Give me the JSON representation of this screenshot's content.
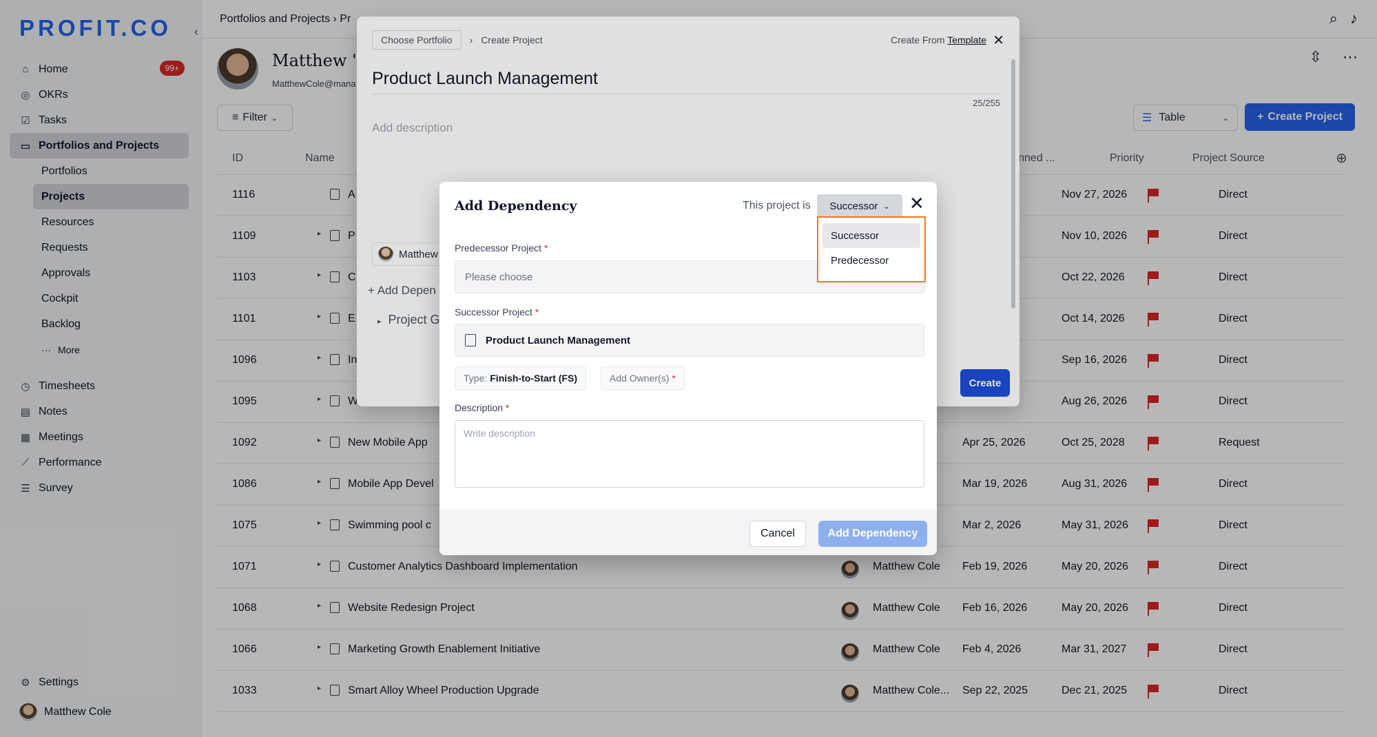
{
  "sidebar": {
    "logo": "PROFIT.CO",
    "items": [
      {
        "label": "Home",
        "icon": "home-icon",
        "badge": "99+"
      },
      {
        "label": "OKRs",
        "icon": "target-icon"
      },
      {
        "label": "Tasks",
        "icon": "checkbox-icon"
      },
      {
        "label": "Portfolios and Projects",
        "icon": "briefcase-icon"
      }
    ],
    "sub_items": [
      "Portfolios",
      "Projects",
      "Resources",
      "Requests",
      "Approvals",
      "Cockpit",
      "Backlog"
    ],
    "more_label": "More",
    "items2": [
      {
        "label": "Timesheets",
        "icon": "timer-icon"
      },
      {
        "label": "Notes",
        "icon": "notes-icon"
      },
      {
        "label": "Meetings",
        "icon": "calendar-icon"
      },
      {
        "label": "Performance",
        "icon": "chart-icon"
      },
      {
        "label": "Survey",
        "icon": "survey-icon"
      }
    ],
    "settings_label": "Settings",
    "user_name": "Matthew Cole"
  },
  "topbar": {
    "breadcrumb": "Portfolios and Projects ›  Pr"
  },
  "header": {
    "title": "Matthew 's P",
    "email": "MatthewCole@mana"
  },
  "toolbar": {
    "filter_label": "Filter",
    "view_label": "Table",
    "create_label": "Create Project"
  },
  "table": {
    "columns": {
      "id": "ID",
      "name": "Name",
      "planned": "Planned ...",
      "priority": "Priority",
      "source": "Project Source"
    },
    "rows": [
      {
        "id": "1116",
        "name": "A",
        "owner": "",
        "start": "",
        "planned": "Nov 27, 2026",
        "source": "Direct"
      },
      {
        "id": "1109",
        "name": "P",
        "owner": "",
        "start": "",
        "planned": "Nov 10, 2026",
        "source": "Direct"
      },
      {
        "id": "1103",
        "name": "C",
        "owner": "",
        "start": "",
        "planned": "Oct 22, 2026",
        "source": "Direct"
      },
      {
        "id": "1101",
        "name": "E",
        "owner": "",
        "start": "",
        "planned": "Oct 14, 2026",
        "source": "Direct"
      },
      {
        "id": "1096",
        "name": "In",
        "owner": "",
        "start": "",
        "planned": "Sep 16, 2026",
        "source": "Direct"
      },
      {
        "id": "1095",
        "name": "W",
        "owner": "",
        "start": "",
        "planned": "Aug 26, 2026",
        "source": "Direct"
      },
      {
        "id": "1092",
        "name": "New Mobile App",
        "owner": "",
        "start": "Apr 25, 2026",
        "planned": "Oct 25, 2028",
        "source": "Request"
      },
      {
        "id": "1086",
        "name": "Mobile App Devel",
        "owner": "",
        "start": "Mar 19, 2026",
        "planned": "Aug 31, 2026",
        "source": "Direct"
      },
      {
        "id": "1075",
        "name": "Swimming pool c",
        "owner": "",
        "start": "Mar 2, 2026",
        "planned": "May 31, 2026",
        "source": "Direct"
      },
      {
        "id": "1071",
        "name": "Customer Analytics Dashboard Implementation",
        "owner": "Matthew Cole",
        "start": "Feb 19, 2026",
        "planned": "May 20, 2026",
        "source": "Direct"
      },
      {
        "id": "1068",
        "name": "Website Redesign Project",
        "owner": "Matthew Cole",
        "start": "Feb 16, 2026",
        "planned": "May 20, 2026",
        "source": "Direct"
      },
      {
        "id": "1066",
        "name": "Marketing Growth Enablement Initiative",
        "owner": "Matthew Cole",
        "start": "Feb 4, 2026",
        "planned": "Mar 31, 2027",
        "source": "Direct"
      },
      {
        "id": "1033",
        "name": "Smart Alloy Wheel Production Upgrade",
        "owner": "Matthew Cole...",
        "start": "Sep 22, 2025",
        "planned": "Dec 21, 2025",
        "source": "Direct"
      }
    ]
  },
  "create_project": {
    "choose_portfolio": "Choose Portfolio",
    "crumb": "Create Project",
    "create_from": "Create From",
    "template": "Template",
    "title": "Product Launch Management",
    "char_count": "25/255",
    "desc_placeholder": "Add description",
    "owner": "Matthew",
    "add_dependency": "+ Add Depen",
    "project_group": "Project G",
    "create_label": "Create"
  },
  "dependency": {
    "title": "Add Dependency",
    "this_project_is": "This project is",
    "selected": "Successor",
    "options": [
      "Successor",
      "Predecessor"
    ],
    "predecessor_label": "Predecessor Project",
    "predecessor_placeholder": "Please choose",
    "successor_label": "Successor Project",
    "successor_value": "Product Launch Management",
    "type_label": "Type:",
    "type_value": "Finish-to-Start (FS)",
    "add_owners": "Add Owner(s)",
    "description_label": "Description",
    "description_placeholder": "Write description",
    "required_mark": "*",
    "cancel_label": "Cancel",
    "add_label": "Add Dependency"
  },
  "colors": {
    "accent": "#2563eb",
    "flag": "#dc2626",
    "highlight": "#f97316"
  }
}
